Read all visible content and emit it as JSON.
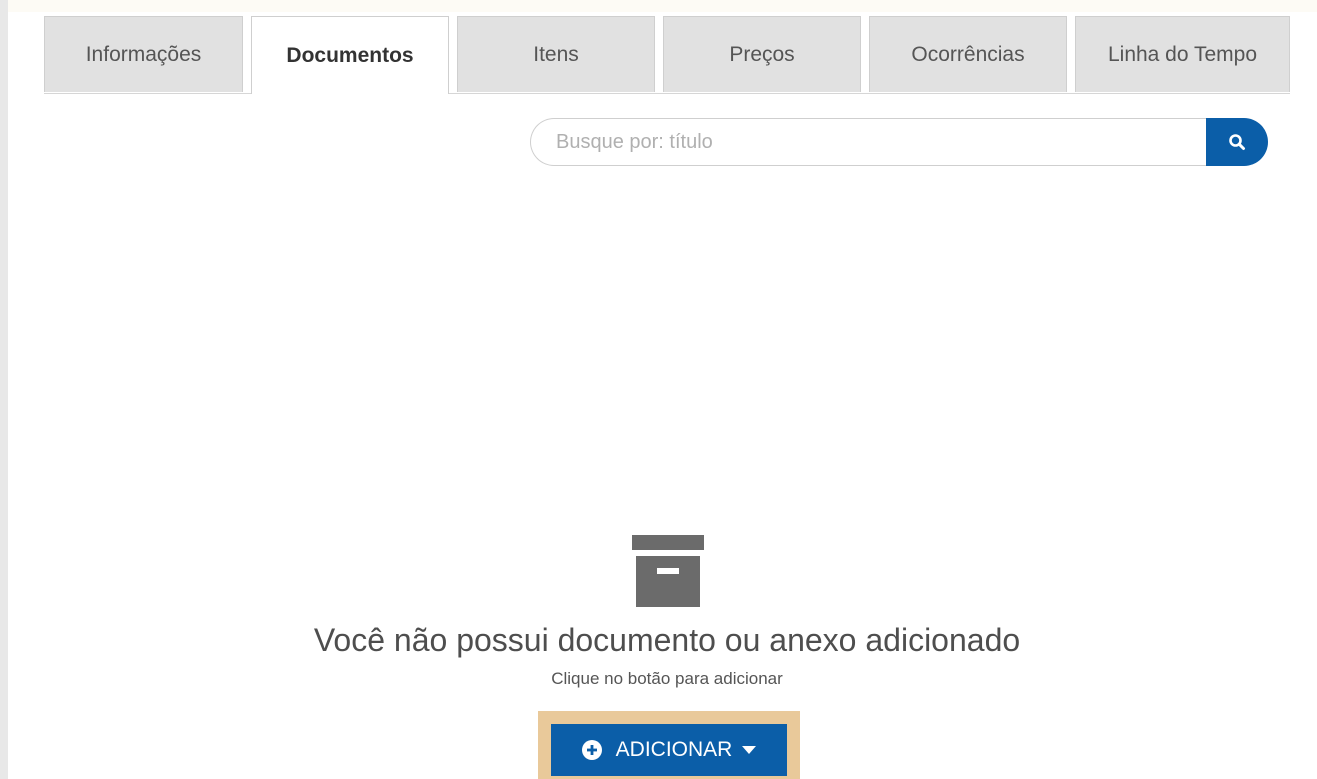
{
  "tabs": [
    {
      "label": "Informações",
      "active": false
    },
    {
      "label": "Documentos",
      "active": true
    },
    {
      "label": "Itens",
      "active": false
    },
    {
      "label": "Preços",
      "active": false
    },
    {
      "label": "Ocorrências",
      "active": false
    },
    {
      "label": "Linha do Tempo",
      "active": false
    }
  ],
  "search": {
    "placeholder": "Busque por: título",
    "value": "",
    "button_icon": "search-icon"
  },
  "empty_state": {
    "icon": "archive-box-icon",
    "title": "Você não possui documento ou anexo adicionado",
    "subtitle": "Clique no botão para adicionar"
  },
  "add_button": {
    "label": "ADICIONAR",
    "icon": "plus-circle-icon",
    "dropdown_icon": "caret-down-icon"
  },
  "colors": {
    "primary": "#0b5ea8",
    "highlight": "#e9c99a",
    "tab_inactive": "#e1e1e1",
    "icon_gray": "#6b6b6b"
  }
}
